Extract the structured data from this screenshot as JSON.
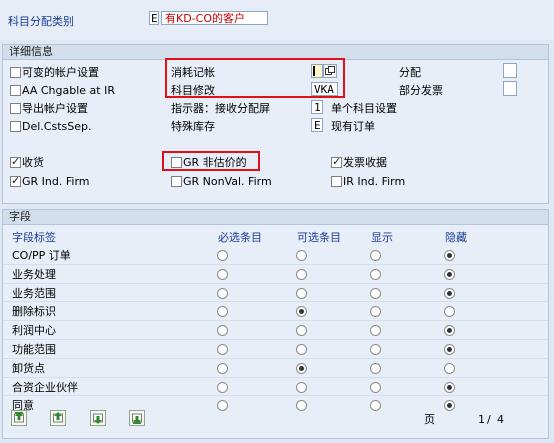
{
  "header": {
    "category_label": "科目分配类别",
    "category_code": "E",
    "category_value": "有KD-CO的客户"
  },
  "details": {
    "title": "详细信息",
    "left": [
      {
        "label": "可变的帐户设置",
        "checked": false
      },
      {
        "label": "AA Chgable at IR",
        "checked": false
      },
      {
        "label": "导出帐户设置",
        "checked": false
      },
      {
        "label": "Del.CstsSep.",
        "checked": false
      }
    ],
    "consumption_label": "消耗记帐",
    "consumption_value": "",
    "acct_mod_label": "科目修改",
    "acct_mod_value": "VKA",
    "indicator_label": "指示器：接收分配屏",
    "indicator_value": "1",
    "indicator_desc": "单个科目设置",
    "special_stock_label": "特殊库存",
    "special_stock_value": "E",
    "special_stock_desc": "现有订单",
    "distribution_label": "分配",
    "partial_invoice_label": "部分发票",
    "flags": [
      {
        "label": "收货",
        "checked": true
      },
      {
        "label": "GR Ind. Firm",
        "checked": true
      },
      {
        "label": "GR 非估价的",
        "checked": false
      },
      {
        "label": "GR NonVal. Firm",
        "checked": false
      },
      {
        "label": "发票收据",
        "checked": true
      },
      {
        "label": "IR Ind. Firm",
        "checked": false
      }
    ]
  },
  "fields": {
    "title": "字段",
    "columns": [
      "字段标签",
      "必选条目",
      "可选条目",
      "显示",
      "隐藏"
    ],
    "rows": [
      {
        "label": "CO/PP 订单",
        "selected": 3
      },
      {
        "label": "业务处理",
        "selected": 3
      },
      {
        "label": "业务范围",
        "selected": 3
      },
      {
        "label": "删除标识",
        "selected": 1
      },
      {
        "label": "利润中心",
        "selected": 3
      },
      {
        "label": "功能范围",
        "selected": 3
      },
      {
        "label": "卸货点",
        "selected": 1
      },
      {
        "label": "合资企业伙伴",
        "selected": 3
      },
      {
        "label": "同意",
        "selected": 3
      }
    ],
    "page_label": "页",
    "page_current": "1",
    "page_total": "4"
  },
  "colors": {
    "highlight_box": "#e01018",
    "label_blue": "#1a3d96",
    "category_value_red": "#c00000"
  },
  "nav_icons": [
    "first-page-icon",
    "previous-page-icon",
    "next-page-icon",
    "last-page-icon"
  ]
}
